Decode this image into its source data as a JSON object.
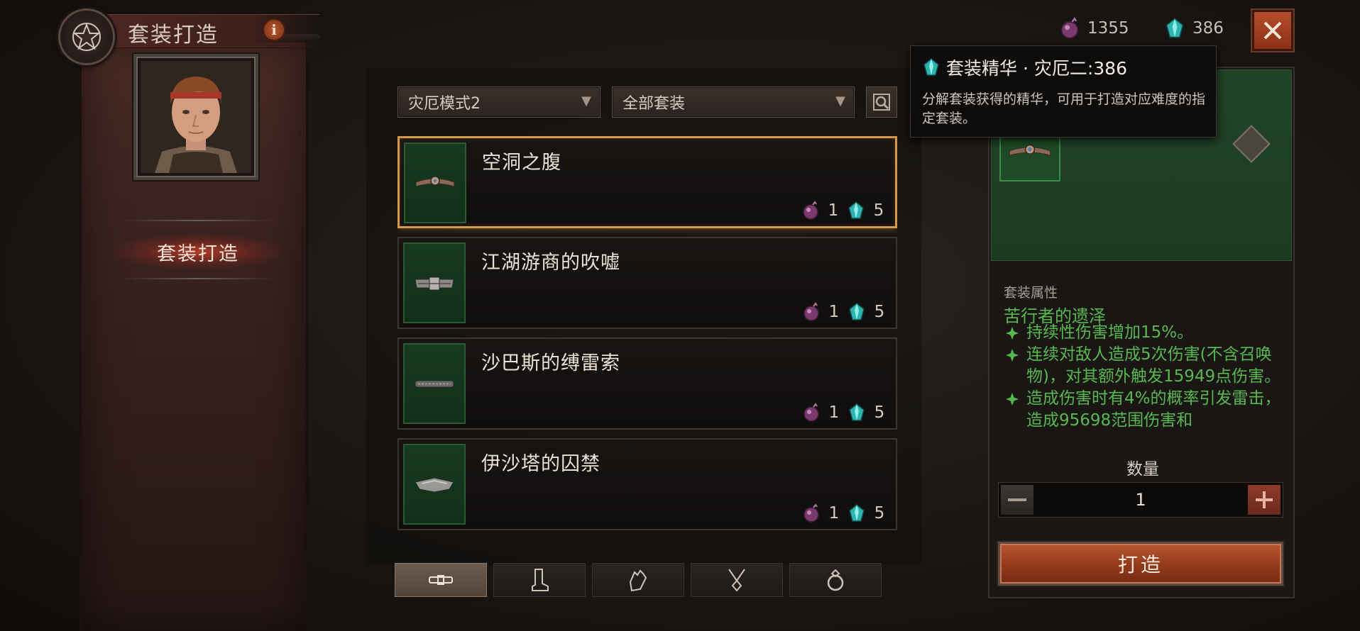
{
  "header": {
    "title": "套装打造",
    "info_label": "i"
  },
  "sidebar": {
    "active_tab": "套装打造"
  },
  "filters": {
    "difficulty": "灾厄模式2",
    "set_filter": "全部套装"
  },
  "items": [
    {
      "name": "空洞之腹",
      "cost_a": "1",
      "cost_b": "5",
      "selected": true
    },
    {
      "name": "江湖游商的吹嘘",
      "cost_a": "1",
      "cost_b": "5",
      "selected": false
    },
    {
      "name": "沙巴斯的缚雷索",
      "cost_a": "1",
      "cost_b": "5",
      "selected": false
    },
    {
      "name": "伊沙塔的囚禁",
      "cost_a": "1",
      "cost_b": "5",
      "selected": false
    }
  ],
  "slot_tabs": [
    "belt-icon",
    "boots-icon",
    "gloves-icon",
    "amulet-icon",
    "ring-icon"
  ],
  "currencies": {
    "essence_a": "1355",
    "essence_b": "386"
  },
  "tooltip": {
    "title": "套装精华 · 灾厄二:386",
    "description": "分解套装获得的精华，可用于打造对应难度的指定套装。"
  },
  "details": {
    "attributes_header": "套装属性",
    "set_name": "苦行者的遗泽",
    "attributes": [
      "持续性伤害增加15%。",
      "连续对敌人造成5次伤害(不含召唤物)，对其额外触发15949点伤害。",
      "造成伤害时有4%的概率引发雷击，造成95698范围伤害和"
    ]
  },
  "quantity": {
    "label": "数量",
    "value": "1"
  },
  "craft_button": "打造",
  "colors": {
    "accent_orange": "#d39a4e",
    "set_green": "#58b84f",
    "craft_red": "#93391b"
  }
}
